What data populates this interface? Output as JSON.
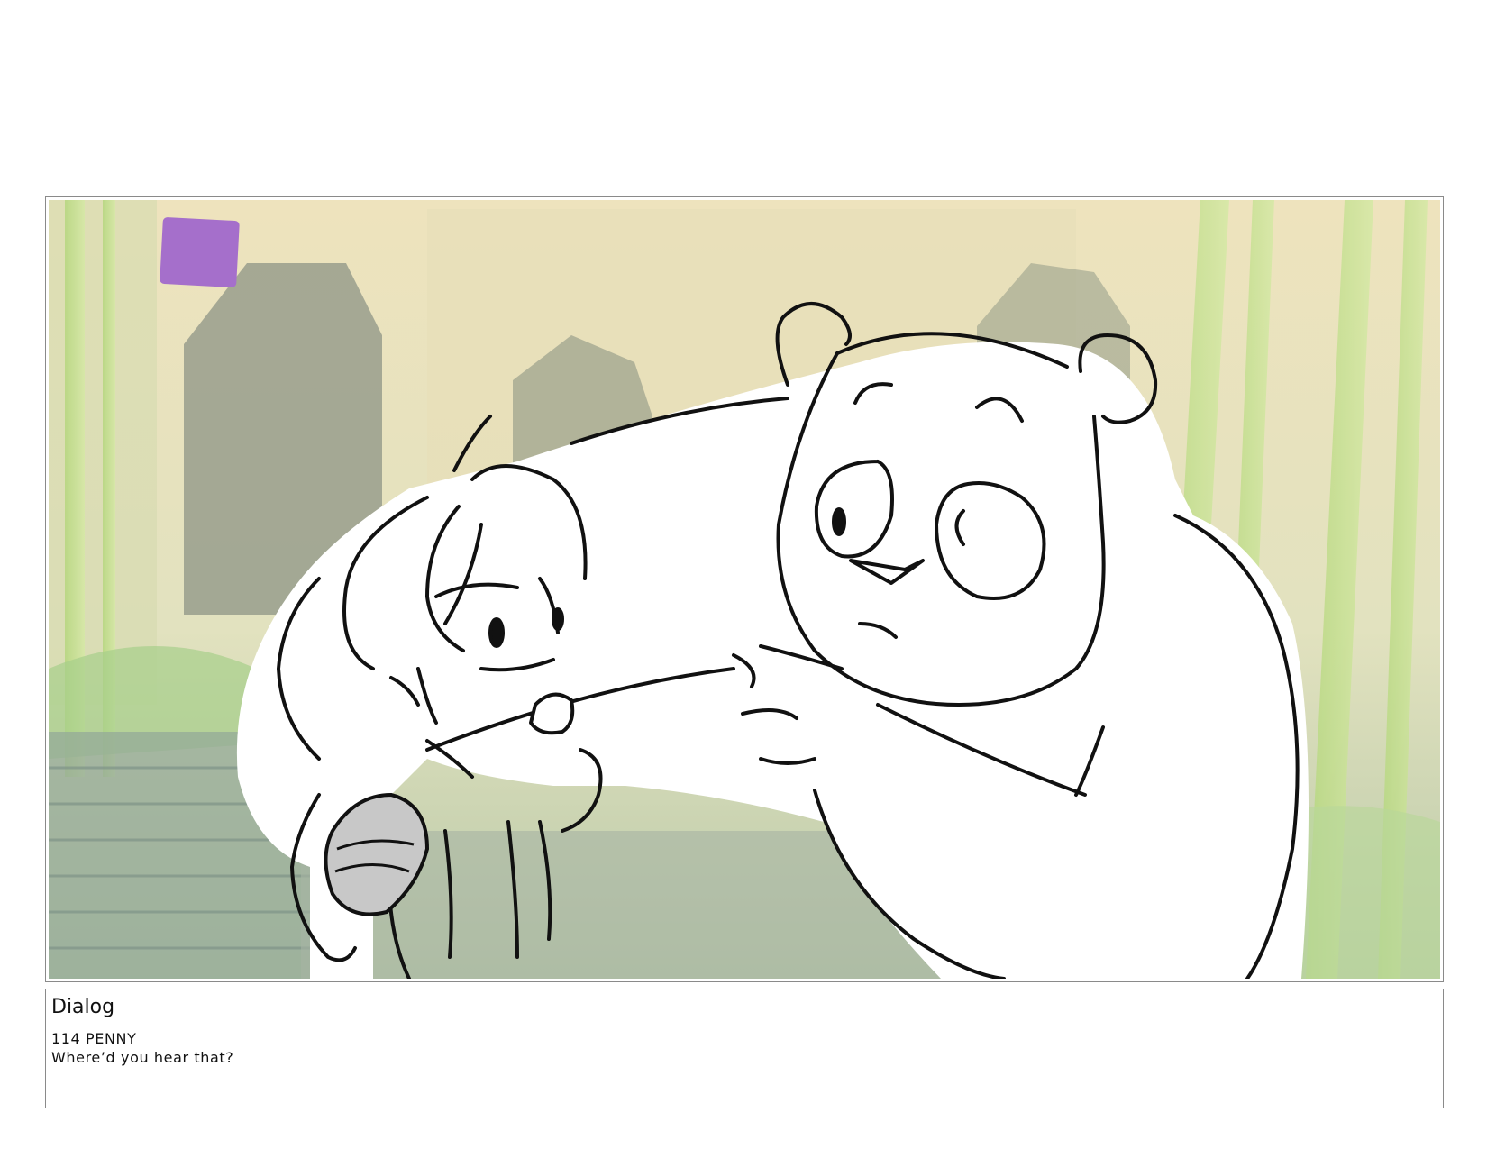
{
  "storyboard_panel": {
    "marker_color": "#a56fcb",
    "background_tint": "#efe6bd",
    "foliage_color": "#a8cf7a"
  },
  "dialog": {
    "heading": "Dialog",
    "line_1": "114 PENNY",
    "line_2": "Where’d you hear that?"
  }
}
